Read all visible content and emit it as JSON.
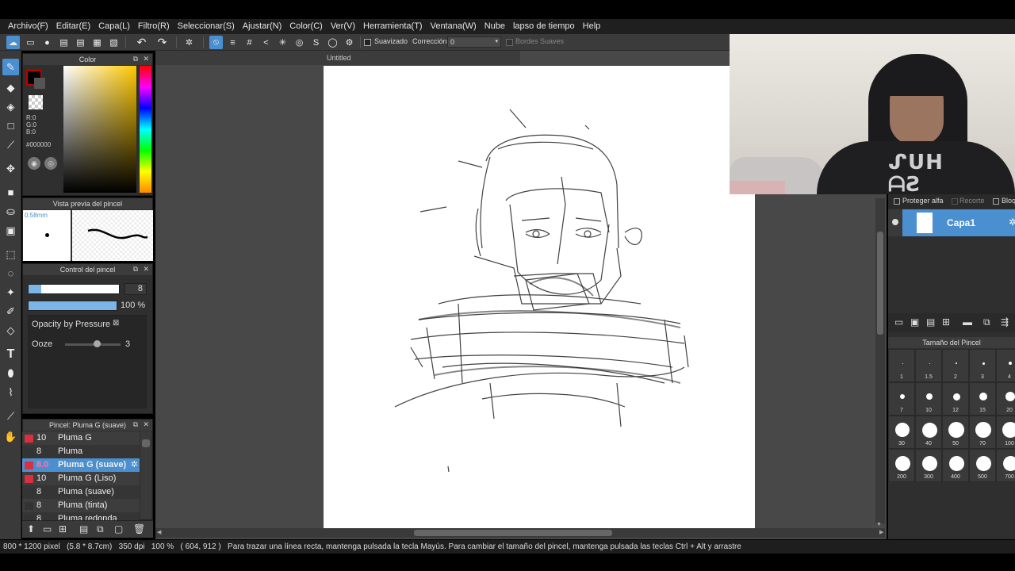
{
  "menu": [
    "Archivo(F)",
    "Editar(E)",
    "Capa(L)",
    "Filtro(R)",
    "Seleccionar(S)",
    "Ajustar(N)",
    "Color(C)",
    "Ver(V)",
    "Herramienta(T)",
    "Ventana(W)",
    "Nube",
    "lapso de tiempo",
    "Help"
  ],
  "toolbar": {
    "smooth_label": "Suavizado",
    "correction_label": "Corrección",
    "correction_value": "0",
    "soft_edges_label": "Bordes Suaves"
  },
  "color_panel": {
    "title": "Color",
    "r": "R:0",
    "g": "G:0",
    "b": "B:0",
    "hex": "#000000",
    "fg_color": "#000000",
    "accent": "#4a8fd0"
  },
  "brush_preview": {
    "title": "Vista previa del pincel",
    "size_text": "0.58mm"
  },
  "brush_control": {
    "title": "Control del pincel",
    "size_value": "8",
    "opacity_value": "100 %",
    "pressure_label": "Opacity by Pressure",
    "ooze_label": "Ooze",
    "ooze_value": "3"
  },
  "brush_list": {
    "title": "Pincel: Pluma G (suave)",
    "items": [
      {
        "size": "10",
        "name": "Pluma G",
        "selected": false
      },
      {
        "size": "8",
        "name": "Pluma",
        "selected": false
      },
      {
        "size": "8.0",
        "name": "Pluma G (suave)",
        "selected": true
      },
      {
        "size": "10",
        "name": "Pluma G (Liso)",
        "selected": false
      },
      {
        "size": "8",
        "name": "Pluma (suave)",
        "selected": false
      },
      {
        "size": "8",
        "name": "Pluma (tinta)",
        "selected": false
      },
      {
        "size": "8",
        "name": "Pluma redonda",
        "selected": false
      }
    ]
  },
  "document": {
    "tab_title": "Untitled"
  },
  "layers": {
    "protect_alpha": "Proteger alfa",
    "clipping": "Recorte",
    "lock": "Bloq",
    "layer_name": "Capa1"
  },
  "brush_size_panel": {
    "title": "Tamaño del Pincel",
    "sizes": [
      "1",
      "1.5",
      "2",
      "3",
      "4",
      "7",
      "10",
      "12",
      "15",
      "20",
      "30",
      "40",
      "50",
      "70",
      "100",
      "200",
      "300",
      "400",
      "500",
      "700"
    ]
  },
  "status": {
    "dims": "800 * 1200 pixel",
    "cm": "(5.8 * 8.7cm)",
    "dpi": "350 dpi",
    "zoom": "100 %",
    "coords": "( 604, 912 )",
    "hint": "Para trazar una línea recta, mantenga pulsada la tecla Mayús. Para cambiar el tamaño del pincel, mantenga pulsada las teclas Ctrl + Alt y arrastre"
  }
}
